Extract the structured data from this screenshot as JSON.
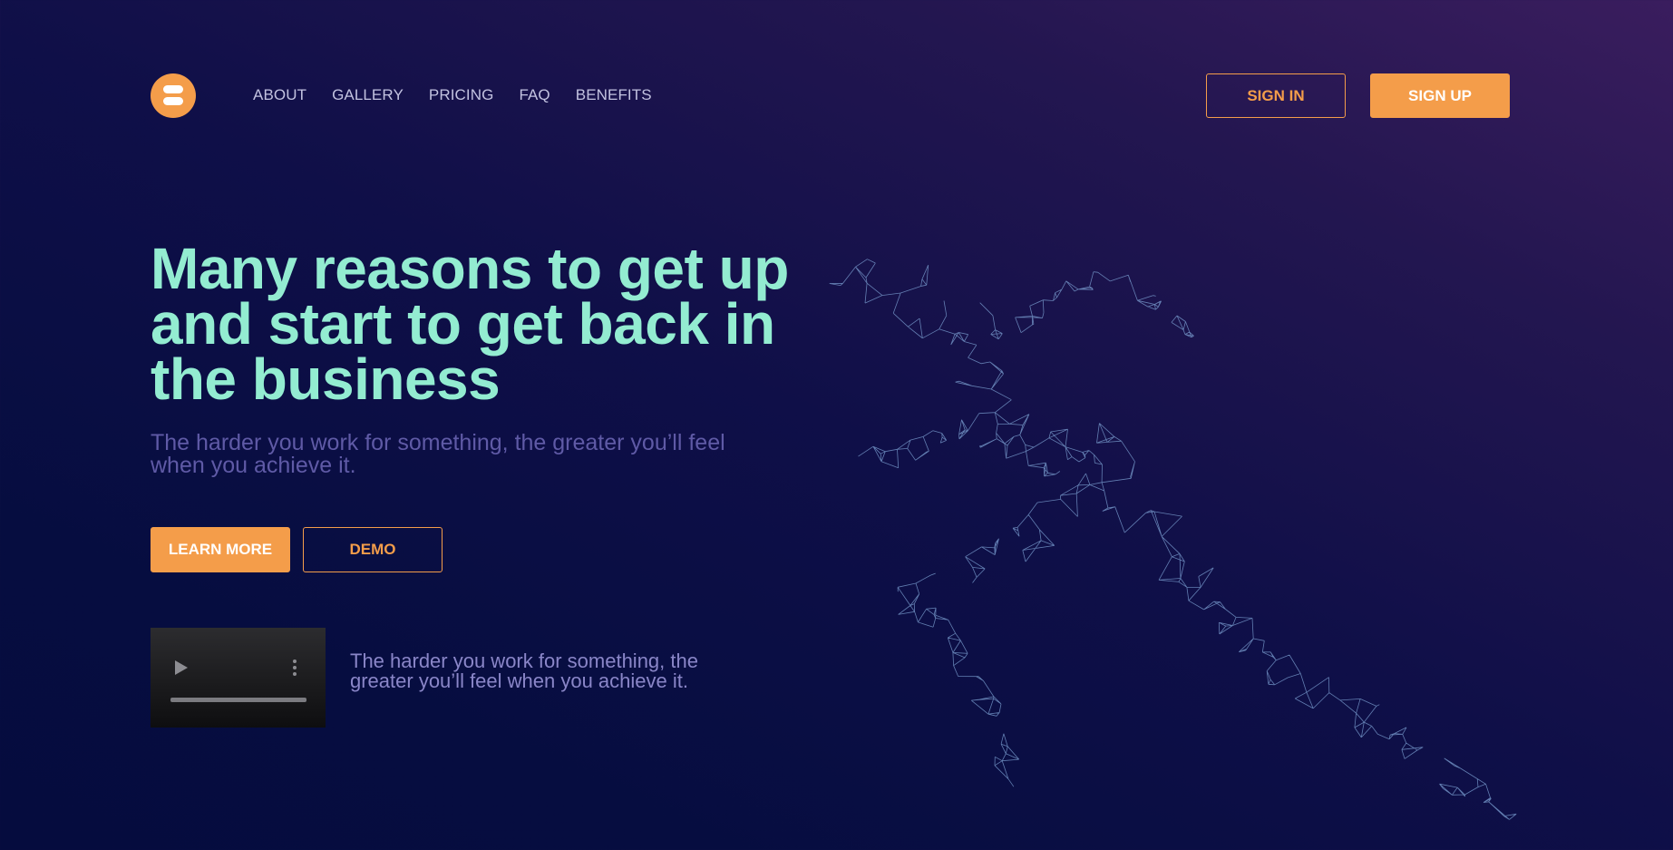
{
  "header": {
    "nav": [
      "ABOUT",
      "GALLERY",
      "PRICING",
      "FAQ",
      "BENEFITS"
    ],
    "sign_in": "SIGN IN",
    "sign_up": "SIGN UP"
  },
  "hero": {
    "title": "Many reasons to get up and start to get back in the business",
    "subtitle": "The harder you work for something, the greater you’ll feel when you achieve it.",
    "learn_more": "LEARN MORE",
    "demo": "DEMO"
  },
  "video": {
    "caption": "The harder you work for something, the greater you’ll feel when you achieve it."
  },
  "colors": {
    "accent": "#f49d4a",
    "title": "#93ecd1",
    "subtitle": "#5f5aa6",
    "wireframe": "#7fa4d6",
    "background_dark": "#050c3e",
    "background_purple": "#3a1d5e"
  },
  "icons": {
    "logo": "stacked-bars-logo-icon",
    "play": "play-icon",
    "more": "more-vertical-icon",
    "illustration": "wireframe-runner-illustration"
  }
}
